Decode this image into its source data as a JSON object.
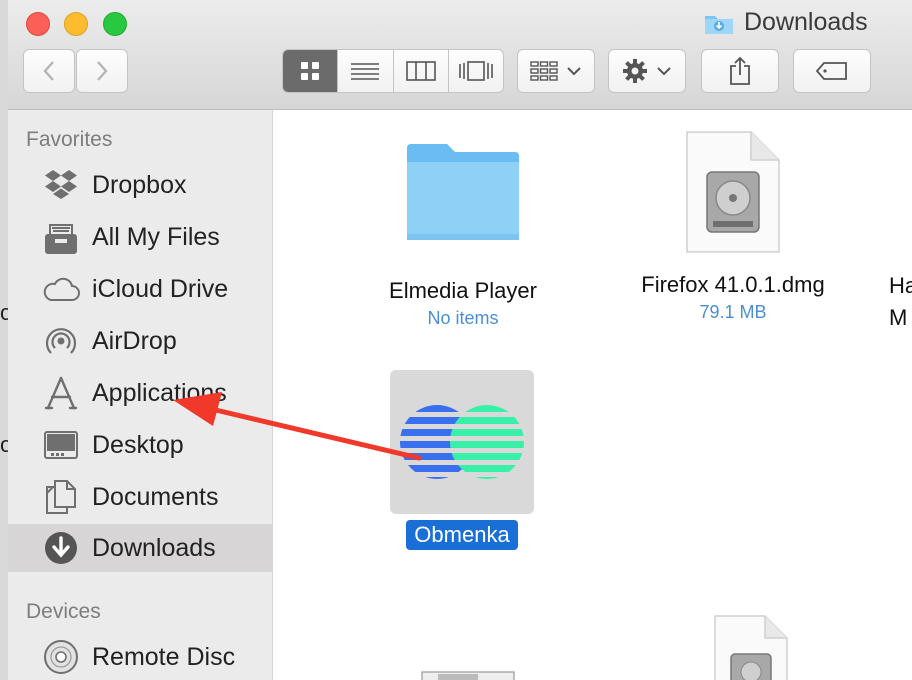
{
  "window": {
    "title": "Downloads"
  },
  "backdrop": {
    "fragment_1": "o",
    "fragment_2": "o"
  },
  "sidebar": {
    "favorites_header": "Favorites",
    "favorites": [
      {
        "label": "Dropbox",
        "icon": "dropbox-icon"
      },
      {
        "label": "All My Files",
        "icon": "all-files-icon"
      },
      {
        "label": "iCloud Drive",
        "icon": "cloud-icon"
      },
      {
        "label": "AirDrop",
        "icon": "airdrop-icon"
      },
      {
        "label": "Applications",
        "icon": "applications-icon"
      },
      {
        "label": "Desktop",
        "icon": "desktop-icon"
      },
      {
        "label": "Documents",
        "icon": "documents-icon"
      },
      {
        "label": "Downloads",
        "icon": "downloads-icon",
        "selected": true
      }
    ],
    "devices_header": "Devices",
    "devices": [
      {
        "label": "Remote Disc",
        "icon": "disc-icon"
      }
    ]
  },
  "files": [
    {
      "name": "Elmedia Player",
      "sub": "No items",
      "kind": "folder"
    },
    {
      "name": "Firefox 41.0.1.dmg",
      "sub": "79.1 MB",
      "kind": "dmg"
    },
    {
      "name": "Ha",
      "sub": "M",
      "kind": "partial"
    },
    {
      "name": "Obmenka",
      "sub": "",
      "kind": "app",
      "selected": true
    }
  ],
  "colors": {
    "folder_blue": "#7cc6f4",
    "selection_blue": "#1a6fd6",
    "arrow_red": "#f0382b",
    "app_blue": "#3a6ff0",
    "app_green": "#39f0a8"
  }
}
